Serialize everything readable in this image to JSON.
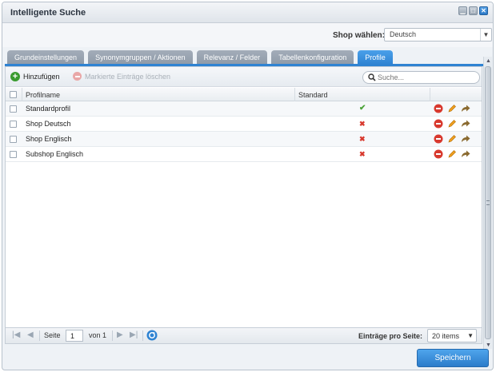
{
  "window": {
    "title": "Intelligente Suche"
  },
  "shop": {
    "label": "Shop wählen:",
    "selected": "Deutsch"
  },
  "tabs": [
    {
      "label": "Grundeinstellungen",
      "active": false
    },
    {
      "label": "Synonymgruppen / Aktionen",
      "active": false
    },
    {
      "label": "Relevanz / Felder",
      "active": false
    },
    {
      "label": "Tabellenkonfiguration",
      "active": false
    },
    {
      "label": "Profile",
      "active": true
    }
  ],
  "toolbar": {
    "add_label": "Hinzufügen",
    "delete_label": "Markierte Einträge löschen",
    "search_placeholder": "Suche..."
  },
  "grid": {
    "columns": [
      "Profilname",
      "Standard"
    ],
    "rows": [
      {
        "name": "Standardprofil",
        "standard": "✔"
      },
      {
        "name": "Shop Deutsch",
        "standard": "✖"
      },
      {
        "name": "Shop Englisch",
        "standard": "✖"
      },
      {
        "name": "Subshop Englisch",
        "standard": "✖"
      }
    ]
  },
  "pager": {
    "page_label": "Seite",
    "page_value": "1",
    "of_label": "von 1",
    "per_page_label": "Einträge pro Seite:",
    "per_page_value": "20 items"
  },
  "footer": {
    "save_label": "Speichern"
  },
  "colors": {
    "accent": "#2f83d2",
    "ok": "#4ca33a",
    "error": "#d8392e"
  }
}
